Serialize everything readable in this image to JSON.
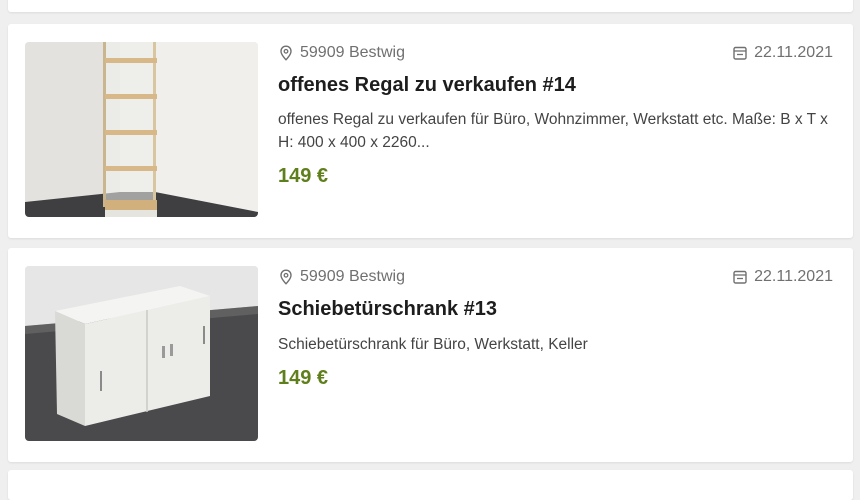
{
  "listings": [
    {
      "location": "59909 Bestwig",
      "date": "22.11.2021",
      "title": "offenes Regal zu verkaufen #14",
      "description": "offenes Regal zu verkaufen für Büro, Wohnzimmer, Werkstatt etc. Maße: B x T x H: 400 x 400 x 2260...",
      "price": "149 €"
    },
    {
      "location": "59909 Bestwig",
      "date": "22.11.2021",
      "title": "Schiebetürschrank #13",
      "description": "Schiebetürschrank für Büro, Werkstatt, Keller",
      "price": "149 €"
    }
  ],
  "colors": {
    "price": "#5e7f1b",
    "background": "#efefef",
    "card": "#ffffff",
    "meta_text": "#707070"
  },
  "icons": {
    "location": "map-pin-icon",
    "date": "calendar-icon"
  }
}
